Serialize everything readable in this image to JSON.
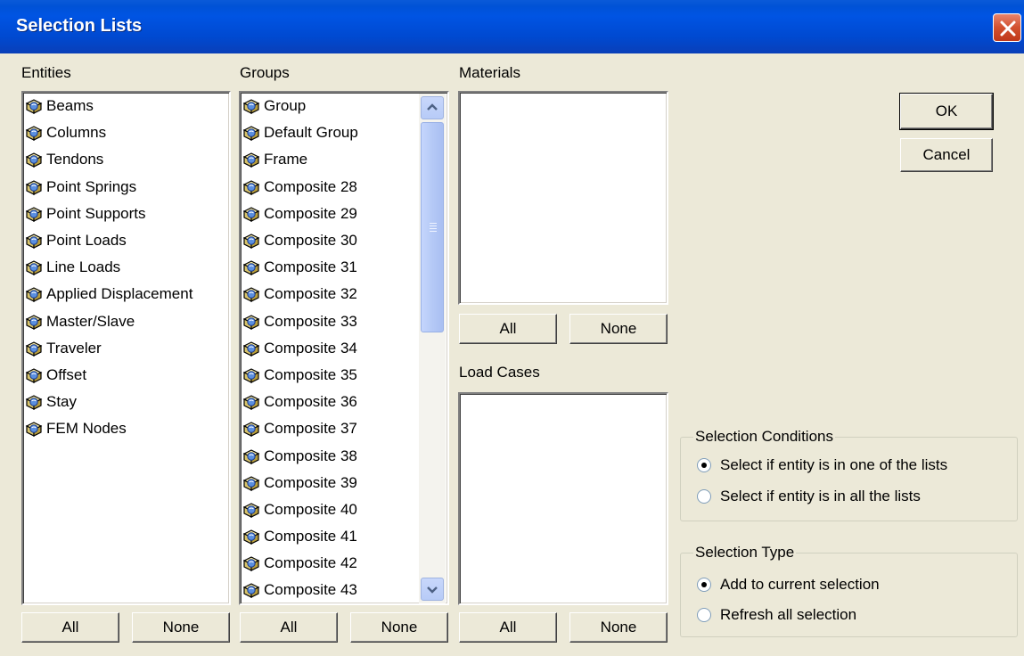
{
  "window": {
    "title": "Selection Lists"
  },
  "entities": {
    "label": "Entities",
    "items": [
      "Beams",
      "Columns",
      "Tendons",
      "Point Springs",
      "Point Supports",
      "Point Loads",
      "Line Loads",
      "Applied Displacement",
      "Master/Slave",
      "Traveler",
      "Offset",
      "Stay",
      "FEM Nodes"
    ],
    "all_label": "All",
    "none_label": "None"
  },
  "groups": {
    "label": "Groups",
    "items": [
      "Group",
      "Default Group",
      "Frame",
      "Composite 28",
      "Composite 29",
      "Composite 30",
      "Composite 31",
      "Composite 32",
      "Composite 33",
      "Composite 34",
      "Composite 35",
      "Composite 36",
      "Composite 37",
      "Composite 38",
      "Composite 39",
      "Composite 40",
      "Composite 41",
      "Composite 42",
      "Composite 43"
    ],
    "all_label": "All",
    "none_label": "None"
  },
  "materials": {
    "label": "Materials",
    "items": [],
    "all_label": "All",
    "none_label": "None"
  },
  "load_cases": {
    "label": "Load Cases",
    "items": [],
    "all_label": "All",
    "none_label": "None"
  },
  "actions": {
    "ok_label": "OK",
    "cancel_label": "Cancel"
  },
  "selection_conditions": {
    "legend": "Selection Conditions",
    "options": [
      "Select if entity is in one of the lists",
      "Select if entity is in all the lists"
    ],
    "selected": 0
  },
  "selection_type": {
    "legend": "Selection Type",
    "options": [
      "Add to current selection",
      "Refresh all selection"
    ],
    "selected": 0
  },
  "colors": {
    "title_bar": "#0054e3",
    "dialog_bg": "#ece9d8",
    "close_button": "#d2502e"
  },
  "icons": {
    "list_item": "package-icon",
    "close": "close-icon"
  }
}
